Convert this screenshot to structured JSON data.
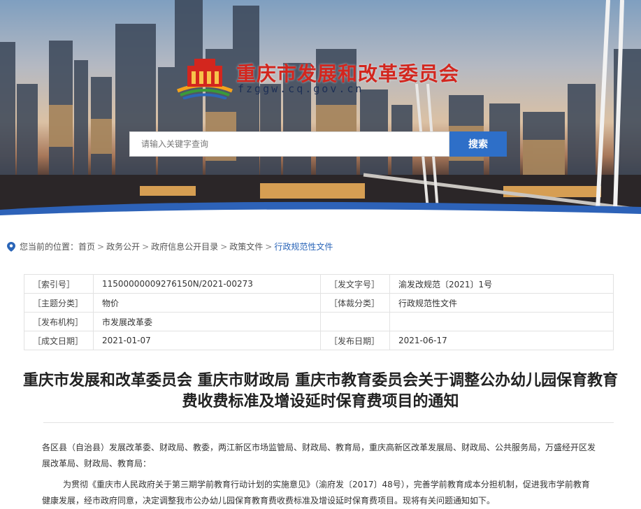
{
  "header": {
    "site_title": "重庆市发展和改革委员会",
    "site_domain": "fzggw.cq.gov.cn",
    "search_placeholder": "请输入关键字查询",
    "search_button": "搜索"
  },
  "breadcrumb": {
    "prefix": "您当前的位置：",
    "items": [
      "首页",
      "政务公开",
      "政府信息公开目录",
      "政策文件",
      "行政规范性文件"
    ]
  },
  "info": {
    "rows": [
      {
        "l1": "［索引号］",
        "v1": "11500000009276150N/2021-00273",
        "l2": "［发文字号］",
        "v2": "渝发改规范〔2021〕1号"
      },
      {
        "l1": "［主题分类］",
        "v1": "物价",
        "l2": "［体裁分类］",
        "v2": "行政规范性文件"
      },
      {
        "l1": "［发布机构］",
        "v1": "市发展改革委",
        "l2": "",
        "v2": ""
      },
      {
        "l1": "［成文日期］",
        "v1": "2021-01-07",
        "l2": "［发布日期］",
        "v2": "2021-06-17"
      }
    ]
  },
  "document": {
    "title": "重庆市发展和改革委员会 重庆市财政局 重庆市教育委员会关于调整公办幼儿园保育教育费收费标准及增设延时保育费项目的通知",
    "para1": "各区县（自治县）发展改革委、财政局、教委，两江新区市场监管局、财政局、教育局，重庆高新区改革发展局、财政局、公共服务局，万盛经开区发展改革局、财政局、教育局：",
    "para2": "为贯彻《重庆市人民政府关于第三期学前教育行动计划的实施意见》（渝府发〔2017〕48号），完善学前教育成本分担机制，促进我市学前教育健康发展，经市政府同意，决定调整我市公办幼儿园保育教育费收费标准及增设延时保育费项目。现将有关问题通知如下。"
  },
  "colors": {
    "brand_red": "#d3261e",
    "accent_blue": "#2e6fc8",
    "link_blue": "#2a65b8"
  }
}
